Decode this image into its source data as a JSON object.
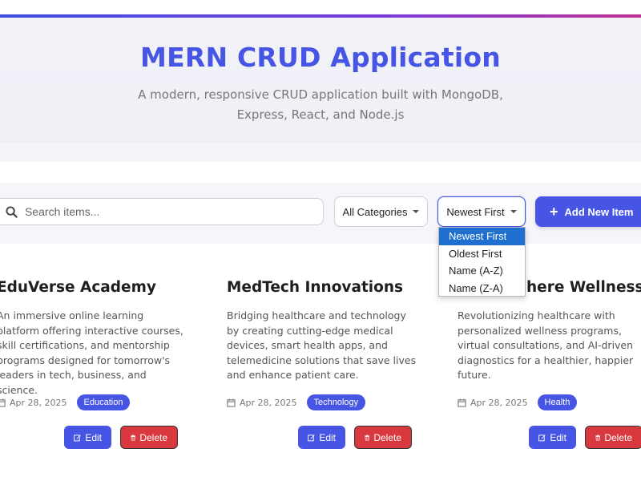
{
  "header": {
    "title": "MERN CRUD Application",
    "subtitle": "A modern, responsive CRUD application built with MongoDB, Express, React, and Node.js"
  },
  "toolbar": {
    "search_placeholder": "Search items...",
    "search_value": "",
    "category_selected": "All Categories",
    "sort_selected": "Newest First",
    "add_label": "Add New Item"
  },
  "sort_options": [
    "Newest First",
    "Oldest First",
    "Name (A-Z)",
    "Name (Z-A)"
  ],
  "items": [
    {
      "title": "EduVerse Academy",
      "description": "An immersive online learning platform offering interactive courses, skill certifications, and mentorship programs designed for tomorrow's leaders in tech, business, and science.",
      "date": "Apr 28, 2025",
      "category": "Education",
      "edit_label": "Edit",
      "delete_label": "Delete"
    },
    {
      "title": "MedTech Innovations",
      "description": "Bridging healthcare and technology by creating cutting-edge medical devices, smart health apps, and telemedicine solutions that save lives and enhance patient care.",
      "date": "Apr 28, 2025",
      "category": "Technology",
      "edit_label": "Edit",
      "delete_label": "Delete"
    },
    {
      "title": "here Wellness",
      "description": "Revolutionizing healthcare with personalized wellness programs, virtual consultations, and AI-driven diagnostics for a healthier, happier future.",
      "date": "Apr 28, 2025",
      "category": "Health",
      "edit_label": "Edit",
      "delete_label": "Delete"
    }
  ],
  "colors": {
    "primary": "#4655e3",
    "danger": "#d9393e",
    "dropdown_highlight": "#1f6fd1"
  },
  "icons": {
    "search": "search-icon",
    "caret": "caret-down-icon",
    "add": "plus-icon",
    "date": "calendar-icon",
    "edit": "edit-icon",
    "delete": "trash-icon"
  }
}
